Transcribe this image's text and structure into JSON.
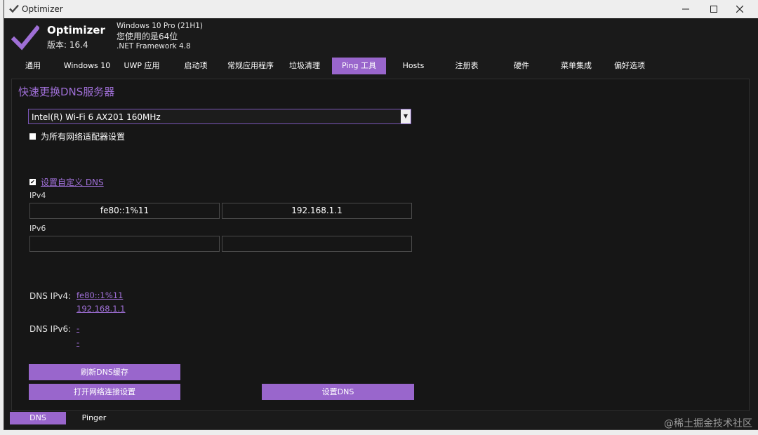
{
  "window": {
    "title": "Optimizer"
  },
  "header": {
    "app_name": "Optimizer",
    "version": "版本: 16.4",
    "os": "Windows 10 Pro (21H1)",
    "arch": "您使用的是64位",
    "framework": ".NET Framework 4.8"
  },
  "tabs": [
    {
      "label": "通用"
    },
    {
      "label": "Windows 10"
    },
    {
      "label": "UWP 应用"
    },
    {
      "label": "启动项"
    },
    {
      "label": "常规应用程序"
    },
    {
      "label": "垃圾清理"
    },
    {
      "label": "Ping 工具"
    },
    {
      "label": "Hosts"
    },
    {
      "label": "注册表"
    },
    {
      "label": "硬件"
    },
    {
      "label": "菜单集成"
    },
    {
      "label": "偏好选项"
    }
  ],
  "active_tab": "Ping 工具",
  "dns": {
    "section_title": "快速更换DNS服务器",
    "adapter_selected": "Intel(R) Wi-Fi 6 AX201 160MHz",
    "all_adapters_label": "为所有网络适配器设置",
    "custom_dns_label": "设置自定义 DNS",
    "ipv4_label": "IPv4",
    "ipv4_primary": "fe80::1%11",
    "ipv4_secondary": "192.168.1.1",
    "ipv6_label": "IPv6",
    "ipv6_primary": "",
    "ipv6_secondary": "",
    "current_ipv4_label": "DNS IPv4:",
    "current_ipv4_values": [
      "fe80::1%11",
      "192.168.1.1"
    ],
    "current_ipv6_label": "DNS IPv6:",
    "current_ipv6_values": [
      "-",
      "-"
    ],
    "flush_button": "刷新DNS缓存",
    "network_settings_button": "打开网络连接设置",
    "set_dns_button": "设置DNS"
  },
  "bottom_tabs": [
    {
      "label": "DNS"
    },
    {
      "label": "Pinger"
    }
  ],
  "watermark": "@稀土掘金技术社区",
  "colors": {
    "accent": "#9966cc",
    "background": "#1a1a1a",
    "link": "#a070d8"
  }
}
